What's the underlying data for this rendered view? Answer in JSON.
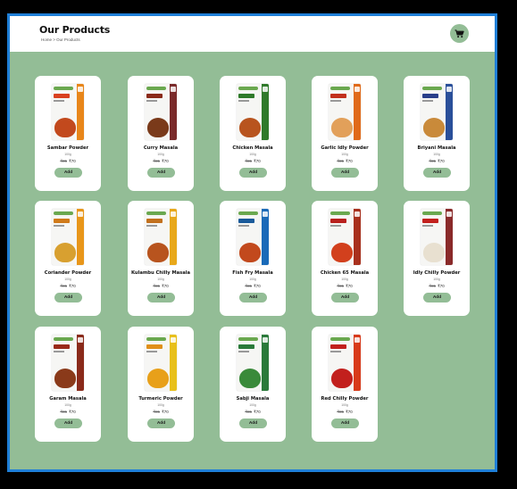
{
  "header": {
    "title": "Our Products",
    "breadcrumb": "Home > Our Products",
    "cart_icon": "cart-icon"
  },
  "colors": {
    "accent": "#93bd96",
    "frame_border": "#1f7fd8",
    "card": "#ffffff"
  },
  "products": [
    {
      "name": "Sambar Powder",
      "weight": "100g",
      "old_price": "₹95",
      "price": "₹70",
      "add_label": "Add",
      "stripe": "#e8861a",
      "food": "#c2491d",
      "tamil": "#d9401f"
    },
    {
      "name": "Curry Masala",
      "weight": "100g",
      "old_price": "₹95",
      "price": "₹70",
      "add_label": "Add",
      "stripe": "#7a2a2a",
      "food": "#7a3a1a",
      "tamil": "#8a2a1a"
    },
    {
      "name": "Chicken Masala",
      "weight": "100g",
      "old_price": "₹95",
      "price": "₹70",
      "add_label": "Add",
      "stripe": "#2f7a2a",
      "food": "#b8541e",
      "tamil": "#2f7a2a"
    },
    {
      "name": "Garlic Idly Powder",
      "weight": "100g",
      "old_price": "₹95",
      "price": "₹70",
      "add_label": "Add",
      "stripe": "#e06a1a",
      "food": "#e2a05a",
      "tamil": "#c2301d"
    },
    {
      "name": "Briyani Masala",
      "weight": "100g",
      "old_price": "₹95",
      "price": "₹70",
      "add_label": "Add",
      "stripe": "#2a4f9a",
      "food": "#c98a3a",
      "tamil": "#2a3f8a"
    },
    {
      "name": "Coriander Powder",
      "weight": "100g",
      "old_price": "₹95",
      "price": "₹70",
      "add_label": "Add",
      "stripe": "#e8961a",
      "food": "#d8a030",
      "tamil": "#d07a1a"
    },
    {
      "name": "Kulambu Chilly Masala",
      "weight": "100g",
      "old_price": "₹95",
      "price": "₹70",
      "add_label": "Add",
      "stripe": "#e8a81a",
      "food": "#b8541e",
      "tamil": "#c2701d"
    },
    {
      "name": "Fish Fry Masala",
      "weight": "100g",
      "old_price": "₹95",
      "price": "₹70",
      "add_label": "Add",
      "stripe": "#1a6ab8",
      "food": "#c2491d",
      "tamil": "#1a5a9a"
    },
    {
      "name": "Chicken 65 Masala",
      "weight": "100g",
      "old_price": "₹95",
      "price": "₹70",
      "add_label": "Add",
      "stripe": "#a8301d",
      "food": "#d2401d",
      "tamil": "#b8201d"
    },
    {
      "name": "Idly Chilly Powder",
      "weight": "100g",
      "old_price": "₹95",
      "price": "₹70",
      "add_label": "Add",
      "stripe": "#8a2a2a",
      "food": "#e8e0d0",
      "tamil": "#c2201d"
    },
    {
      "name": "Garam Masala",
      "weight": "100g",
      "old_price": "₹95",
      "price": "₹70",
      "add_label": "Add",
      "stripe": "#8a2a1a",
      "food": "#8a3a1a",
      "tamil": "#9a2a1a"
    },
    {
      "name": "Turmeric Powder",
      "weight": "100g",
      "old_price": "₹95",
      "price": "₹70",
      "add_label": "Add",
      "stripe": "#e8c01a",
      "food": "#e8a01a",
      "tamil": "#e0901a"
    },
    {
      "name": "Sabji Masala",
      "weight": "100g",
      "old_price": "₹95",
      "price": "₹70",
      "add_label": "Add",
      "stripe": "#2a7a3a",
      "food": "#3a8a3a",
      "tamil": "#2a7a3a"
    },
    {
      "name": "Red Chilly Powder",
      "weight": "100g",
      "old_price": "₹95",
      "price": "₹70",
      "add_label": "Add",
      "stripe": "#d83a1a",
      "food": "#c2201d",
      "tamil": "#c2201d"
    }
  ]
}
